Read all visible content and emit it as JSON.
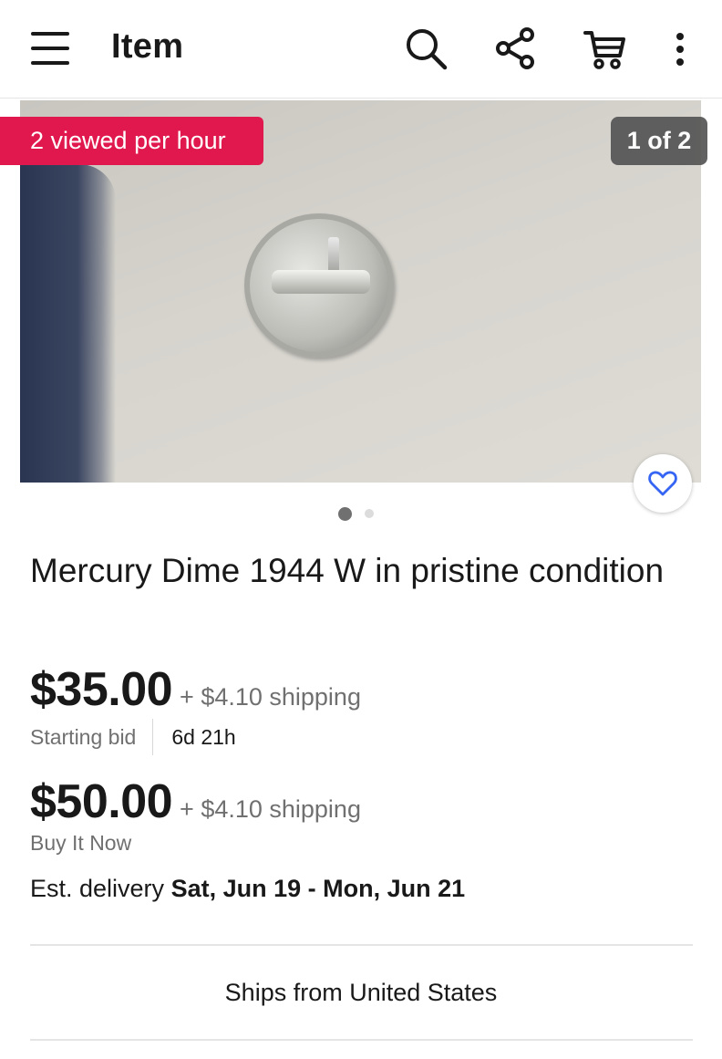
{
  "header": {
    "title": "Item",
    "icons": [
      "menu-icon",
      "search-icon",
      "share-icon",
      "cart-icon",
      "more-vertical-icon"
    ]
  },
  "gallery": {
    "views_badge": "2 viewed per hour",
    "image_counter": "1 of 2",
    "image_position": 1,
    "image_total": 2,
    "favorite_icon": "heart-icon"
  },
  "listing": {
    "title": "Mercury Dime 1944 W in pristine condition",
    "auction": {
      "price": "$35.00",
      "shipping": "+ $4.10 shipping",
      "label": "Starting bid",
      "time_left": "6d 21h"
    },
    "buy_now": {
      "price": "$50.00",
      "shipping": "+ $4.10 shipping",
      "label": "Buy It Now"
    },
    "delivery": {
      "prefix": "Est. delivery",
      "dates": "Sat, Jun 19 - Mon, Jun 21"
    },
    "ships_from": "Ships from United States"
  },
  "colors": {
    "accent_badge": "#e0184d",
    "favorite": "#3665f3",
    "text_primary": "#191919",
    "text_secondary": "#707070"
  }
}
